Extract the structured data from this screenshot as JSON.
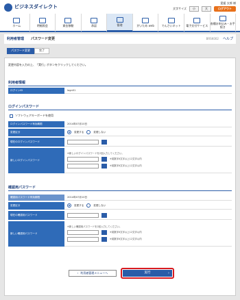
{
  "header": {
    "brand": "ビジネスダイレクト",
    "user_name": "愛媛 太郎 様",
    "text_size_label": "文字サイズ",
    "logout_label": "ログアウト",
    "nav": [
      {
        "label": "ホーム",
        "icon": "home-icon"
      },
      {
        "label": "明細照会",
        "icon": "statement-icon"
      },
      {
        "label": "資金移動",
        "icon": "transfer-icon"
      },
      {
        "label": "承認",
        "icon": "approve-icon"
      },
      {
        "label": "管理",
        "icon": "manage-icon",
        "active": true
      },
      {
        "label": "がいため web",
        "icon": "forex-icon"
      },
      {
        "label": "でんさいネット",
        "icon": "densai-icon"
      },
      {
        "label": "電子交付サービス",
        "icon": "document-icon"
      },
      {
        "label": "各種お申込み・お手続き",
        "icon": "application-icon"
      }
    ]
  },
  "title": {
    "category": "利用者管理",
    "page": "パスワード変更",
    "code": "BRSK002",
    "help": "ヘルプ"
  },
  "steps": [
    "パスワード変更",
    "完了"
  ],
  "intro": "変更内容を入力の上、「実行」ボタンをクリックしてください。",
  "user_info": {
    "heading": "利用者情報",
    "login_id_label": "ログインID",
    "login_id_value": "logn01"
  },
  "login_pw": {
    "heading": "ログインパスワード",
    "software_kb": "ソフトウェアキーボードを使用",
    "expiry_label": "ログインパスワード有効期限",
    "expiry_value": "2014年07月10日",
    "change_label": "変更区分",
    "opt_change": "変更する",
    "opt_nochange": "変更しない",
    "current_label": "現在のログインパスワード",
    "new_label": "新しいログインパスワード",
    "new_note": "※新しいログインパスワードを2回入力してください。",
    "rule1": "※英数字6文字以上12文字以内",
    "rule2": "※英数字6文字以上12文字以内"
  },
  "confirm_pw": {
    "heading": "確認用パスワード",
    "expiry_label": "確認用パスワード有効期限",
    "expiry_value": "2014年07月10日",
    "change_label": "変更区分",
    "opt_change": "変更する",
    "opt_nochange": "変更しない",
    "current_label": "現在の確認用パスワード",
    "new_label": "新しい確認用パスワード",
    "new_note": "※新しい確認用パスワードを2回入力してください。",
    "rule1": "※英数字6文字以上12文字以内",
    "rule2": "※英数字6文字以上12文字以内"
  },
  "buttons": {
    "back": "利用者管理メニューへ",
    "exec": "実行"
  }
}
